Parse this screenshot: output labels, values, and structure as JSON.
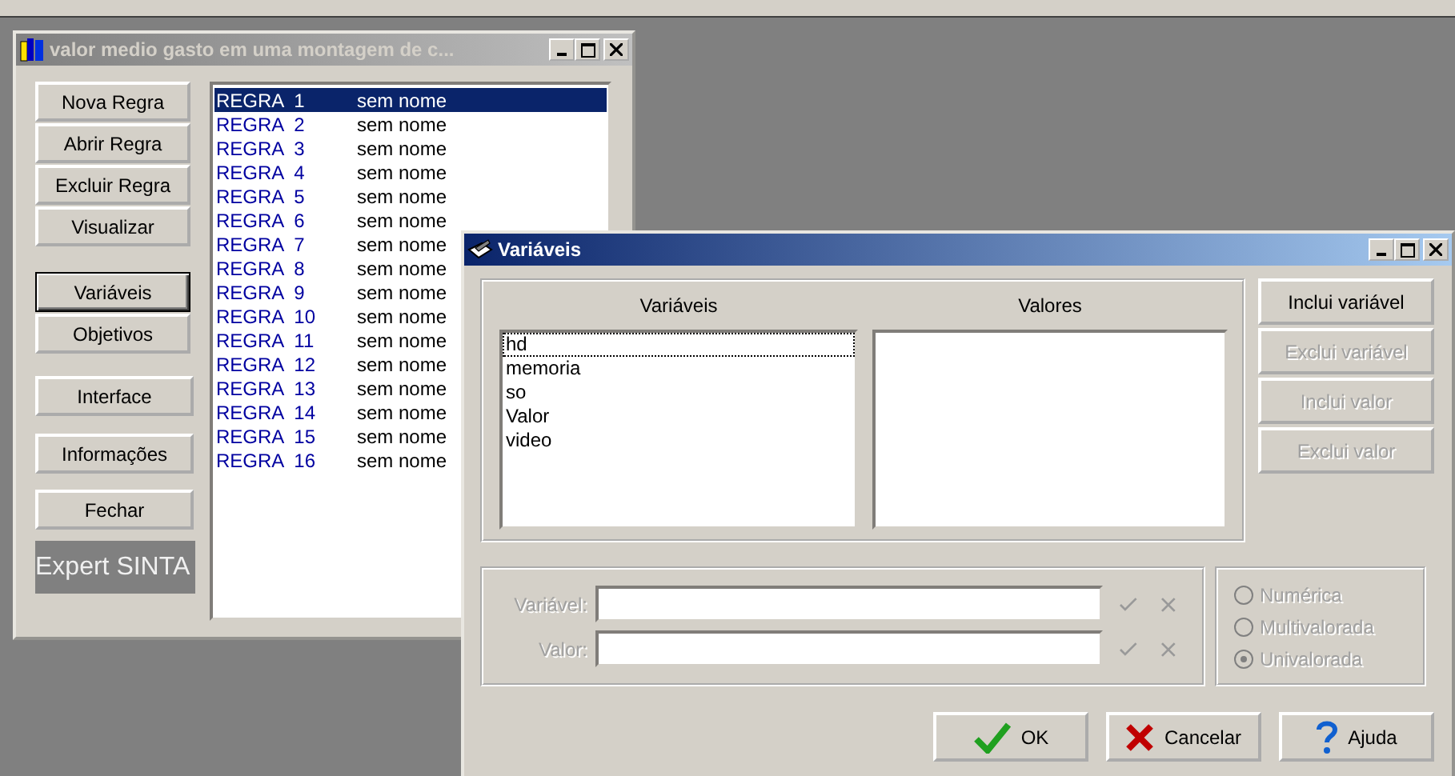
{
  "main_window": {
    "title": "valor medio gasto em uma montagem de c...",
    "active": false,
    "buttons": [
      {
        "label": "Nova Regra",
        "focused": false
      },
      {
        "label": "Abrir Regra",
        "focused": false
      },
      {
        "label": "Excluir Regra",
        "focused": false
      },
      {
        "label": "Visualizar",
        "focused": false
      },
      {
        "label": "Variáveis",
        "focused": true
      },
      {
        "label": "Objetivos",
        "focused": false
      },
      {
        "label": "Interface",
        "focused": false
      },
      {
        "label": "Informações",
        "focused": false
      },
      {
        "label": "Fechar",
        "focused": false
      }
    ],
    "logo": "Expert SINTA",
    "rules": [
      {
        "name": "REGRA  1",
        "description": "sem nome",
        "selected": true
      },
      {
        "name": "REGRA  2",
        "description": "sem nome",
        "selected": false
      },
      {
        "name": "REGRA  3",
        "description": "sem nome",
        "selected": false
      },
      {
        "name": "REGRA  4",
        "description": "sem nome",
        "selected": false
      },
      {
        "name": "REGRA  5",
        "description": "sem nome",
        "selected": false
      },
      {
        "name": "REGRA  6",
        "description": "sem nome",
        "selected": false
      },
      {
        "name": "REGRA  7",
        "description": "sem nome",
        "selected": false
      },
      {
        "name": "REGRA  8",
        "description": "sem nome",
        "selected": false
      },
      {
        "name": "REGRA  9",
        "description": "sem nome",
        "selected": false
      },
      {
        "name": "REGRA  10",
        "description": "sem nome",
        "selected": false
      },
      {
        "name": "REGRA  11",
        "description": "sem nome",
        "selected": false
      },
      {
        "name": "REGRA  12",
        "description": "sem nome",
        "selected": false
      },
      {
        "name": "REGRA  13",
        "description": "sem nome",
        "selected": false
      },
      {
        "name": "REGRA  14",
        "description": "sem nome",
        "selected": false
      },
      {
        "name": "REGRA  15",
        "description": "sem nome",
        "selected": false
      },
      {
        "name": "REGRA  16",
        "description": "sem nome",
        "selected": false
      }
    ]
  },
  "dialog": {
    "title": "Variáveis",
    "active": true,
    "variables_heading": "Variáveis",
    "values_heading": "Valores",
    "variables": [
      {
        "label": "hd",
        "focused": true
      },
      {
        "label": "memoria",
        "focused": false
      },
      {
        "label": "so",
        "focused": false
      },
      {
        "label": "Valor",
        "focused": false
      },
      {
        "label": "video",
        "focused": false
      }
    ],
    "side_buttons": [
      {
        "label": "Inclui variável",
        "disabled": false
      },
      {
        "label": "Exclui variável",
        "disabled": true
      },
      {
        "label": "Inclui valor",
        "disabled": true
      },
      {
        "label": "Exclui valor",
        "disabled": true
      }
    ],
    "fields": [
      {
        "label": "Variável:",
        "disabled": true
      },
      {
        "label": "Valor:",
        "disabled": true
      }
    ],
    "types": [
      {
        "label": "Numérica",
        "selected": false,
        "disabled": true
      },
      {
        "label": "Multivalorada",
        "selected": false,
        "disabled": true
      },
      {
        "label": "Univalorada",
        "selected": true,
        "disabled": true
      }
    ],
    "footer_buttons": [
      {
        "label": "OK",
        "kind": "ok"
      },
      {
        "label": "Cancelar",
        "kind": "cancel"
      },
      {
        "label": "Ajuda",
        "kind": "help"
      }
    ]
  }
}
